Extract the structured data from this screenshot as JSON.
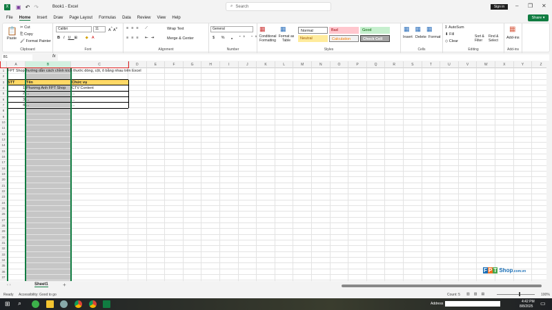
{
  "window": {
    "title": "Book1 - Excel",
    "search_placeholder": "Search",
    "sign_in": "Sign in",
    "share": "Share"
  },
  "menu": [
    "File",
    "Home",
    "Insert",
    "Draw",
    "Page Layout",
    "Formulas",
    "Data",
    "Review",
    "View",
    "Help"
  ],
  "ribbon": {
    "clipboard": {
      "label": "Clipboard",
      "paste": "Paste",
      "cut": "Cut",
      "copy": "Copy",
      "format_painter": "Format Painter"
    },
    "font": {
      "label": "Font",
      "font_name": "Calibri",
      "font_size": "11"
    },
    "alignment": {
      "label": "Alignment",
      "wrap": "Wrap Text",
      "merge": "Merge & Center"
    },
    "number": {
      "label": "Number",
      "format": "General"
    },
    "styles": {
      "label": "Styles",
      "conditional": "Conditional Formatting",
      "format_table": "Format as Table",
      "normal": "Normal",
      "bad": "Bad",
      "good": "Good",
      "neutral": "Neutral",
      "calculation": "Calculation",
      "check_cell": "Check Cell"
    },
    "cells": {
      "label": "Cells",
      "insert": "Insert",
      "delete": "Delete",
      "format": "Format"
    },
    "editing": {
      "label": "Editing",
      "autosum": "AutoSum",
      "fill": "Fill",
      "clear": "Clear",
      "sort": "Sort & Filter",
      "find": "Find & Select"
    },
    "addins": {
      "label": "Add-ins",
      "addins": "Add-ins"
    }
  },
  "formula_bar": {
    "name_box": "B1",
    "fx": "fx",
    "value": ""
  },
  "columns": [
    "A",
    "B",
    "C",
    "D",
    "E",
    "F",
    "G",
    "H",
    "I",
    "J",
    "K",
    "L",
    "M",
    "N",
    "O",
    "P",
    "Q",
    "R",
    "S",
    "T",
    "U",
    "V",
    "W",
    "X",
    "Y",
    "Z"
  ],
  "selected_column": "B",
  "rows": 37,
  "cells": {
    "A1": "FPT Shop",
    "B1": "hướng dẫn cách chỉnh kích thước dòng, cột, ô bằng nhau trên Excel",
    "A3": "STT",
    "B3": "Tên",
    "C3": "Chức vụ",
    "A4": "1",
    "B4": "Phương Anh FPT Shop",
    "C4": "CTV Content",
    "A5": "2",
    "B5": "...",
    "C5": "...",
    "A6": "3",
    "B6": "...",
    "C6": "...",
    "A7": "4",
    "B7": "...",
    "C7": "..."
  },
  "sheet_tab": "Sheet1",
  "status": {
    "ready": "Ready",
    "accessibility": "Accessibility: Good to go",
    "count": "Count: 5",
    "zoom": "100%"
  },
  "taskbar": {
    "address_label": "Address",
    "time": "4:42 PM",
    "date": "8/8/2025"
  },
  "watermark": "FPT Shop.com.vn",
  "colors": {
    "excel_green": "#107c41",
    "header_fill": "#ffd966",
    "selection": "#c6c6c6",
    "highlight_box": "#e02020"
  }
}
